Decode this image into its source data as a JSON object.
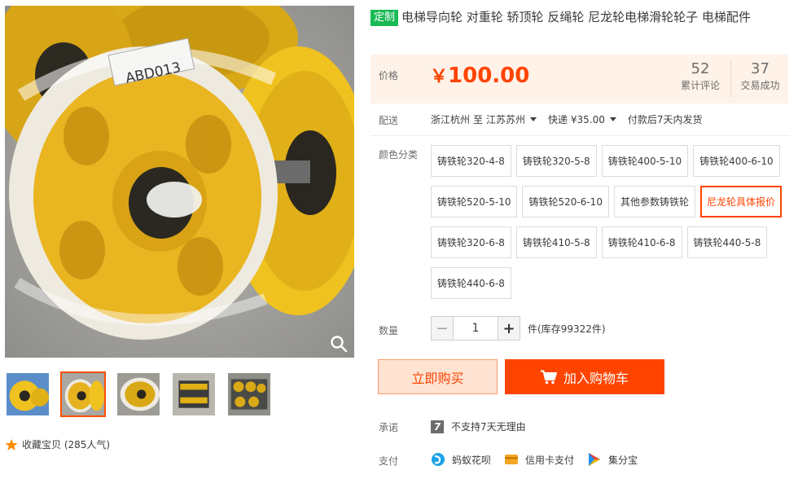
{
  "product": {
    "tag": "定制",
    "title": "电梯导向轮 对重轮 轿顶轮 反绳轮 尼龙轮电梯滑轮轮子 电梯配件",
    "image_label": "ABD013"
  },
  "price": {
    "label": "价格",
    "currency": "￥",
    "value": "100.00",
    "reviews_count": "52",
    "reviews_label": "累计评论",
    "sales_count": "37",
    "sales_label": "交易成功"
  },
  "delivery": {
    "label": "配送",
    "from": "浙江杭州",
    "to_word": "至",
    "to": "江苏苏州",
    "shipping": "快递 ¥35.00",
    "dispatch": "付款后7天内发货"
  },
  "sku": {
    "label": "颜色分类",
    "rows": [
      [
        "铸铁轮320-4-8",
        "铸铁轮320-5-8",
        "铸铁轮400-5-10",
        "铸铁轮400-6-10"
      ],
      [
        "铸铁轮520-5-10",
        "铸铁轮520-6-10",
        "其他参数铸铁轮",
        "尼龙轮具体报价"
      ],
      [
        "铸铁轮320-6-8",
        "铸铁轮410-5-8",
        "铸铁轮410-6-8",
        "铸铁轮440-5-8"
      ],
      [
        "铸铁轮440-6-8"
      ]
    ],
    "selected": "尼龙轮具体报价"
  },
  "quantity": {
    "label": "数量",
    "minus": "−",
    "value": "1",
    "plus": "+",
    "stock": "件(库存99322件)"
  },
  "actions": {
    "buy_now": "立即购买",
    "add_to_cart": "加入购物车"
  },
  "promise": {
    "label": "承诺",
    "icon_text": "7",
    "text": "不支持7天无理由"
  },
  "payment": {
    "label": "支付",
    "methods": [
      "蚂蚁花呗",
      "信用卡支付",
      "集分宝"
    ]
  },
  "favorite": {
    "text": "收藏宝贝 (285人气)"
  },
  "colors": {
    "accent": "#ff4400",
    "price_bg": "#fff2e8",
    "tag_green": "#19b955",
    "wheel_yellow": "#e8b41e"
  },
  "icons": [
    "zoom-icon",
    "star-icon",
    "cart-icon",
    "seven-day-icon",
    "huabei-icon",
    "credit-card-icon",
    "jifenbao-icon"
  ]
}
